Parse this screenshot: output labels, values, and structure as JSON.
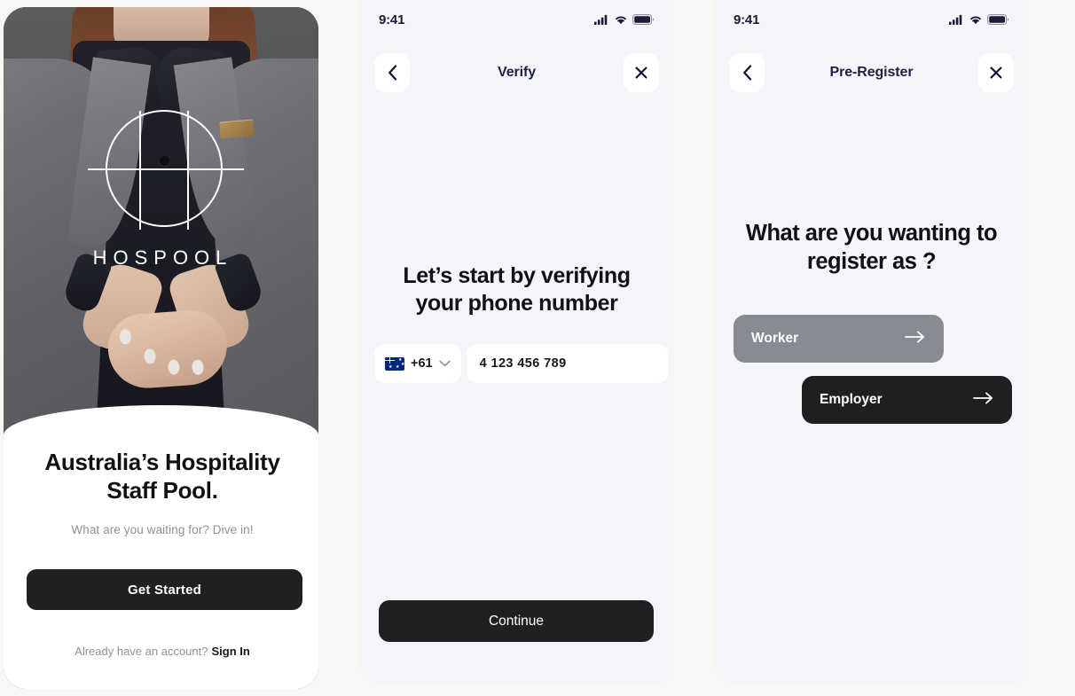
{
  "app": {
    "brand": "HOSPOOL",
    "accent_dark": "#202022",
    "accent_gray": "#878c92",
    "title_color": "#221f45",
    "panel_bg": "#f4f5f9",
    "page_bg": "#f7f7f6"
  },
  "screen1": {
    "name": "onboarding",
    "logo_word": "HOSPOOL",
    "title": "Australia’s Hospitality Staff Pool.",
    "subtitle": "What are you waiting for? Dive in!",
    "cta_label": "Get Started",
    "footer_text": "Already have an account?",
    "footer_link": "Sign In"
  },
  "screen2": {
    "name": "verify",
    "statusbar": {
      "clock": "9:41",
      "icons": [
        "signal-icon",
        "wifi-icon",
        "battery-icon"
      ]
    },
    "nav": {
      "back_icon": "chevron-left-icon",
      "title": "Verify",
      "close_icon": "close-icon"
    },
    "heading": "Let’s start by verifying your phone number",
    "country": {
      "flag": "flag-australia",
      "code": "+61",
      "chevron": "chevron-down-icon"
    },
    "phone": {
      "placeholder": "4 123 456 789",
      "value": "4 123 456 789"
    },
    "continue_label": "Continue"
  },
  "screen3": {
    "name": "pre-register",
    "statusbar": {
      "clock": "9:41",
      "icons": [
        "signal-icon",
        "wifi-icon",
        "battery-icon"
      ]
    },
    "nav": {
      "back_icon": "chevron-left-icon",
      "title": "Pre-Register",
      "close_icon": "close-icon"
    },
    "heading": "What are you wanting to register as ?",
    "options": [
      {
        "label": "Worker",
        "arrow": "arrow-right-icon",
        "color": "#878c92"
      },
      {
        "label": "Employer",
        "arrow": "arrow-right-icon",
        "color": "#1f1f21"
      }
    ]
  }
}
